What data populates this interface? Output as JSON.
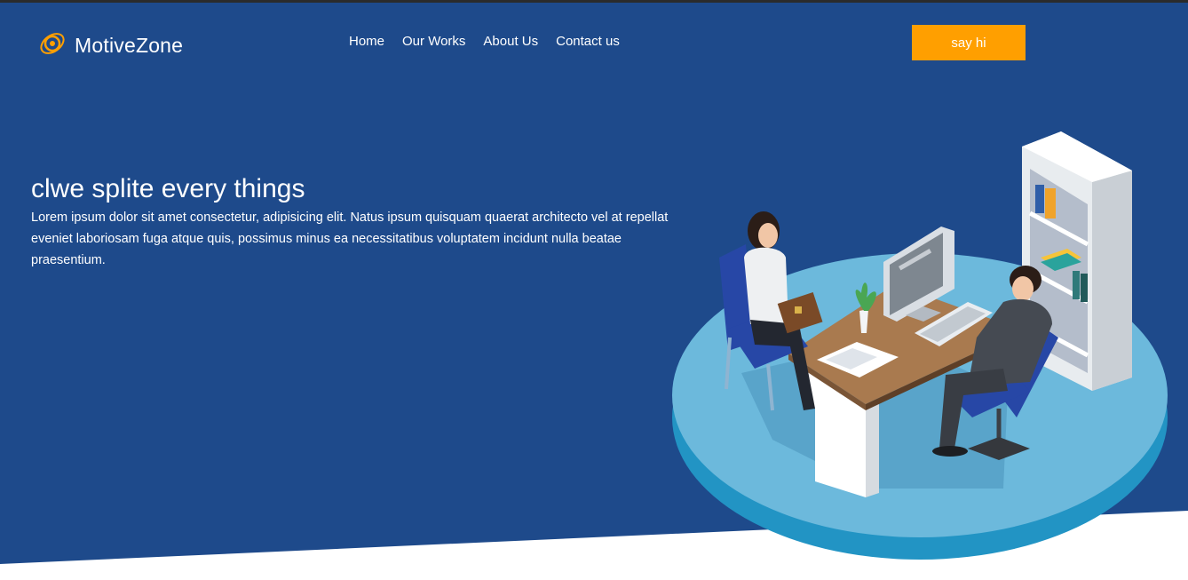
{
  "brand": {
    "name": "MotiveZone",
    "icon": "gear-icon",
    "accent_color": "#ff9f00",
    "hero_color": "#1e4a8b"
  },
  "nav": {
    "items": [
      {
        "label": "Home"
      },
      {
        "label": "Our Works"
      },
      {
        "label": "About Us"
      },
      {
        "label": "Contact us"
      }
    ]
  },
  "cta": {
    "label": "say hi"
  },
  "hero": {
    "title": "clwe splite every things",
    "description": "Lorem ipsum dolor sit amet consectetur, adipisicing elit. Natus ipsum quisquam quaerat architecto vel at repellat eveniet laboriosam fuga atque quis, possimus minus ea necessitatibus voluptatem incidunt nulla beatae praesentium."
  },
  "illustration": {
    "icon": "office-meeting-illustration"
  }
}
